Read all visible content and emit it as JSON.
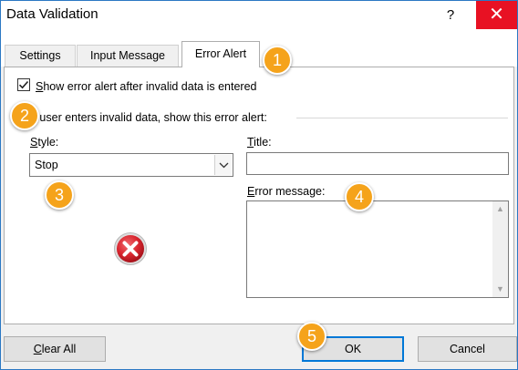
{
  "window": {
    "title": "Data Validation",
    "help_label": "?",
    "close_label": "✕"
  },
  "tabs": [
    {
      "label": "Settings",
      "active": false
    },
    {
      "label": "Input Message",
      "active": false
    },
    {
      "label": "Error Alert",
      "active": true
    }
  ],
  "error_alert": {
    "checkbox": {
      "checked": true,
      "label_first": "S",
      "label_rest": "how error alert after invalid data is entered"
    },
    "group_label": "n user enters invalid data, show this error alert:",
    "style_label_first": "S",
    "style_label_rest": "tyle:",
    "style_value": "Stop",
    "title_label_first": "T",
    "title_label_rest": "itle:",
    "title_value": "",
    "message_label_first": "E",
    "message_label_rest": "rror message:",
    "message_value": ""
  },
  "buttons": {
    "clear_all_first": "C",
    "clear_all_rest": "lear All",
    "ok": "OK",
    "cancel": "Cancel"
  },
  "callouts": [
    "1",
    "2",
    "3",
    "4",
    "5"
  ],
  "colors": {
    "callout": "#f5a31b",
    "close": "#e81123",
    "error_icon": "#d9262f",
    "default_button_border": "#0078d7"
  },
  "icons": {
    "check": "checkmark-icon",
    "dropdown": "chevron-down-icon",
    "error": "error-stop-icon"
  }
}
